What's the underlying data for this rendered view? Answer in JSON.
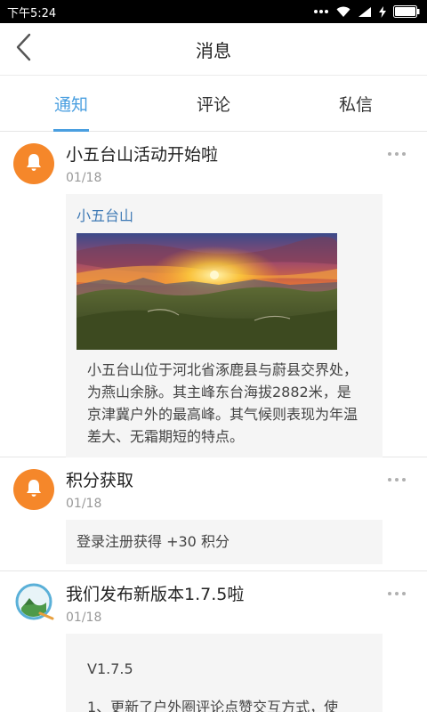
{
  "status_bar": {
    "time": "下午5:24",
    "icons": [
      "more-dots-icon",
      "wifi-icon",
      "signal-icon",
      "charging-icon",
      "battery-icon"
    ]
  },
  "nav": {
    "title": "消息",
    "back_icon": "back-chevron-icon"
  },
  "tabs": [
    {
      "label": "通知",
      "active": true
    },
    {
      "label": "评论",
      "active": false
    },
    {
      "label": "私信",
      "active": false
    }
  ],
  "colors": {
    "accent": "#4a9fe0",
    "notice_avatar": "#f5872a",
    "link": "#3f7ab5"
  },
  "messages": [
    {
      "title": "小五台山活动开始啦",
      "date": "01/18",
      "avatar_icon": "bell-icon",
      "card": {
        "link": "小五台山",
        "image": "sunset-mountain-photo",
        "text": "小五台山位于河北省涿鹿县与蔚县交界处，为燕山余脉。其主峰东台海拔2882米，是京津冀户外的最高峰。其气候则表现为年温差大、无霜期短的特点。"
      }
    },
    {
      "title": "积分获取",
      "date": "01/18",
      "avatar_icon": "bell-icon",
      "card": {
        "text": "登录注册获得 +30 积分"
      }
    },
    {
      "title": "我们发布新版本1.7.5啦",
      "date": "01/18",
      "avatar_icon": "app-logo-icon",
      "card": {
        "version": "V1.7.5",
        "text": "1、更新了户外圈评论点赞交互方式，使"
      }
    }
  ]
}
